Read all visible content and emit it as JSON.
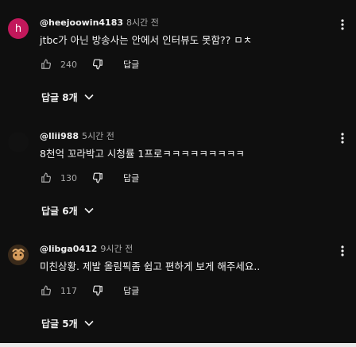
{
  "comments": [
    {
      "handle": "@heejoowin4183",
      "time": "8시간 전",
      "text": "jtbc가 아닌 방송사는 안에서 인터뷰도 못함?? ㅁㅊ",
      "likes": "240",
      "reply_label": "답글",
      "replies_label": "답글 8개",
      "avatar_letter": "h",
      "avatar_color": "#c2185b"
    },
    {
      "handle": "@llii988",
      "time": "5시간 전",
      "text": "8천억 꼬라박고 시청률 1프로ㅋㅋㅋㅋㅋㅋㅋㅋㅋ",
      "likes": "130",
      "reply_label": "답글",
      "replies_label": "답글 6개",
      "avatar_color": "#111111"
    },
    {
      "handle": "@libga0412",
      "time": "9시간 전",
      "text": "미친상황. 제발 올림픽좀 쉽고 편하게 보게 해주세요..",
      "likes": "117",
      "reply_label": "답글",
      "replies_label": "답글 5개",
      "avatar_color": "#3a2a1a"
    }
  ],
  "icons": {
    "like": "thumbs-up-icon",
    "dislike": "thumbs-down-icon",
    "menu": "more-vert-icon",
    "expand": "chevron-down-icon"
  }
}
